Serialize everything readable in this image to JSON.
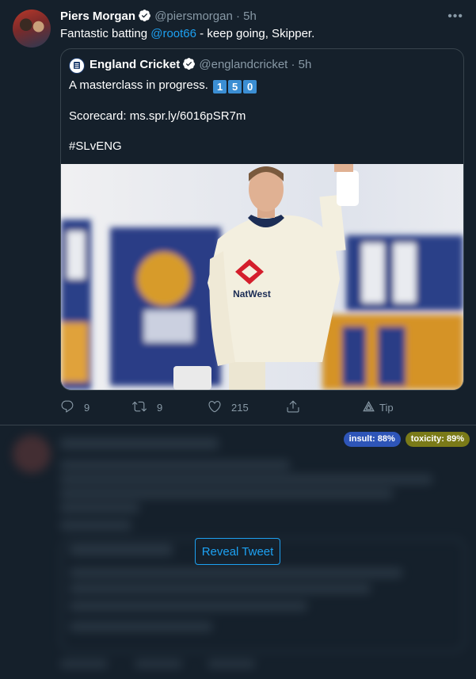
{
  "tweet": {
    "author_name": "Piers Morgan",
    "handle": "@piersmorgan",
    "separator": "·",
    "time": "5h",
    "more_label": "•••",
    "text_before": "Fantastic batting ",
    "mention": "@root66",
    "text_after": " - keep going, Skipper."
  },
  "quoted_tweet": {
    "author_name": "England Cricket",
    "handle": "@englandcricket",
    "separator": "·",
    "time": "5h",
    "line1": "A masterclass in progress.",
    "keycaps": [
      "1",
      "5",
      "0"
    ],
    "line2": "Scorecard: ms.spr.ly/6016pSR7m",
    "line3": "#SLvENG",
    "media_text": [
      "NatWest"
    ]
  },
  "actions": {
    "replies": "9",
    "retweets": "9",
    "likes": "215",
    "tip_label": "Tip"
  },
  "moderation": {
    "badges": [
      {
        "label": "insult: 88%",
        "color": "#2e55b8"
      },
      {
        "label": "toxicity: 89%",
        "color": "#7a7a18"
      }
    ],
    "reveal_label": "Reveal Tweet"
  },
  "colors": {
    "background": "#15202b",
    "link": "#1da1f2",
    "muted": "#8899a6",
    "border": "#38444d"
  }
}
